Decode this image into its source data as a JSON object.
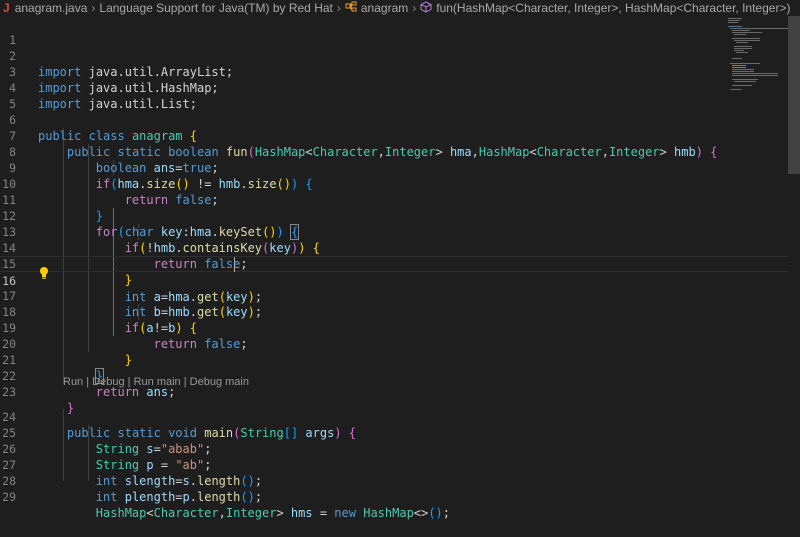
{
  "breadcrumb": {
    "file": "anagram.java",
    "extension": "Language Support for Java(TM) by Red Hat",
    "class": "anagram",
    "method": "fun(HashMap<Character, Integer>, HashMap<Character, Integer>)"
  },
  "codelens": {
    "run": "Run",
    "debug": "Debug",
    "run_main": "Run main",
    "debug_main": "Debug main",
    "separator": " | "
  },
  "line_numbers": [
    "1",
    "2",
    "3",
    "4",
    "5",
    "6",
    "7",
    "8",
    "9",
    "10",
    "11",
    "12",
    "13",
    "14",
    "15",
    "16",
    "17",
    "18",
    "19",
    "20",
    "21",
    "22",
    "23",
    "24",
    "25",
    "26",
    "27",
    "28",
    "29"
  ],
  "code": {
    "l2": {
      "kw": "import",
      "path": "java.util.ArrayList;"
    },
    "l3": {
      "kw": "import",
      "path": "java.util.HashMap;"
    },
    "l4": {
      "kw": "import",
      "path": "java.util.List;"
    },
    "l6": {
      "a": "public",
      "b": "class",
      "name": "anagram",
      "brace": "{"
    },
    "l7": {
      "a": "public",
      "b": "static",
      "c": "boolean",
      "fn": "fun",
      "p1": "(",
      "t1": "HashMap",
      "lt1": "<",
      "t2": "Character",
      "c1": ",",
      "t3": "Integer",
      "gt1": ">",
      "v1": "hma",
      "c2": ",",
      "t4": "HashMap",
      "lt2": "<",
      "t5": "Character",
      "c3": ",",
      "t6": "Integer",
      "gt2": ">",
      "v2": "hmb",
      "p2": ")",
      "brace": "{"
    },
    "l8": {
      "t": "boolean",
      "v": "ans",
      "eq": "=",
      "val": "true",
      "semi": ";"
    },
    "l9": {
      "kw": "if",
      "p1": "(",
      "v1": "hma",
      "dot1": ".",
      "fn1": "size",
      "pp1": "()",
      "op": " != ",
      "v2": "hmb",
      "dot2": ".",
      "fn2": "size",
      "pp2": "()",
      "p2": ")",
      "brace": "{"
    },
    "l10": {
      "kw": "return",
      "val": "false",
      "semi": ";"
    },
    "l11": {
      "brace": "}"
    },
    "l12": {
      "kw": "for",
      "p1": "(",
      "t": "char",
      "v1": "key",
      "colon": ":",
      "v2": "hma",
      "dot": ".",
      "fn": "keySet",
      "pp": "()",
      "p2": ")",
      "brace": "{"
    },
    "l13": {
      "kw": "if",
      "p1": "(",
      "not": "!",
      "v": "hmb",
      "dot": ".",
      "fn": "containsKey",
      "p2": "(",
      "arg": "key",
      "p3": ")",
      "p4": ")",
      "brace": "{"
    },
    "l14": {
      "kw": "return",
      "val": "false",
      "semi": ";"
    },
    "l15": {
      "brace": "}"
    },
    "l16": {
      "t": "int",
      "v1": "a",
      "eq": "=",
      "v2": "hma",
      "dot": ".",
      "fn": "get",
      "p1": "(",
      "arg": "key",
      "p2": ")",
      "semi": ";"
    },
    "l17": {
      "t": "int",
      "v1": "b",
      "eq": "=",
      "v2": "hmb",
      "dot": ".",
      "fn": "get",
      "p1": "(",
      "arg": "key",
      "p2": ")",
      "semi": ";"
    },
    "l18": {
      "kw": "if",
      "p1": "(",
      "v1": "a",
      "op": "!=",
      "v2": "b",
      "p2": ")",
      "brace": "{"
    },
    "l19": {
      "kw": "return",
      "val": "false",
      "semi": ";"
    },
    "l20": {
      "brace": "}"
    },
    "l21": {
      "brace": "}"
    },
    "l22": {
      "kw": "return",
      "v": "ans",
      "semi": ";"
    },
    "l23": {
      "brace": "}"
    },
    "l24": {
      "a": "public",
      "b": "static",
      "c": "void",
      "fn": "main",
      "p1": "(",
      "t": "String",
      "arr": "[]",
      "v": "args",
      "p2": ")",
      "brace": "{"
    },
    "l25": {
      "t": "String",
      "v": "s",
      "eq": "=",
      "val": "\"abab\"",
      "semi": ";"
    },
    "l26": {
      "t": "String",
      "v": "p",
      "eq": " = ",
      "val": "\"ab\"",
      "semi": ";"
    },
    "l27": {
      "t": "int",
      "v1": "slength",
      "eq": "=",
      "v2": "s",
      "dot": ".",
      "fn": "length",
      "pp": "()",
      "semi": ";"
    },
    "l28": {
      "t": "int",
      "v1": "plength",
      "eq": "=",
      "v2": "p",
      "dot": ".",
      "fn": "length",
      "pp": "()",
      "semi": ";"
    },
    "l29": {
      "t1": "HashMap",
      "lt": "<",
      "t2": "Character",
      "c": ",",
      "t3": "Integer",
      "gt": ">",
      "v": "hms",
      "eq": " = ",
      "kw": "new",
      "t4": "HashMap",
      "dia": "<>",
      "pp": "()",
      "semi": ";"
    }
  },
  "colors": {
    "background": "#1e1e1e",
    "keyword": "#569cd6",
    "control": "#c586c0",
    "type": "#4ec9b0",
    "function": "#dcdcaa",
    "variable": "#9cdcfe",
    "string": "#ce9178",
    "bracket_1": "#ffd700",
    "bracket_2": "#da70d6",
    "bracket_3": "#179fff"
  },
  "icons": {
    "file": "java-file-icon",
    "class": "class-symbol-icon",
    "method": "method-symbol-icon",
    "lightbulb": "lightbulb-icon"
  }
}
